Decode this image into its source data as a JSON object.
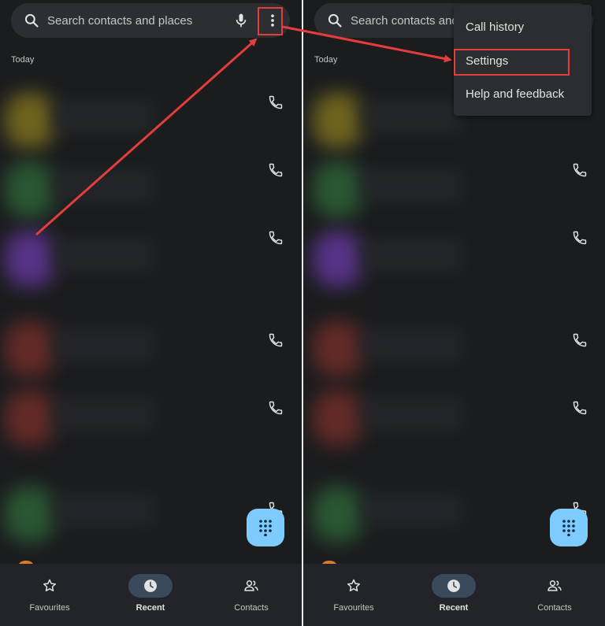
{
  "search": {
    "placeholder": "Search contacts and places"
  },
  "call_log": {
    "section_label": "Today"
  },
  "overflow_menu": {
    "items": [
      {
        "label": "Call history"
      },
      {
        "label": "Settings"
      },
      {
        "label": "Help and feedback"
      }
    ]
  },
  "bottom_nav": {
    "items": [
      {
        "label": "Favourites",
        "icon": "star-icon"
      },
      {
        "label": "Recent",
        "icon": "clock-icon",
        "active": true
      },
      {
        "label": "Contacts",
        "icon": "people-icon"
      }
    ]
  },
  "colors": {
    "background": "#1b1c1e",
    "search_bar": "#2c2e31",
    "fab": "#7ecbff",
    "highlight": "#e53c3c",
    "nav_bar": "#222427",
    "menu": "#2b2d31"
  },
  "blurred_avatar_colors": [
    "#8a7a1e",
    "#2f6b3a",
    "#6b3aa8",
    "#7a2f2a",
    "#7a2f2a",
    "#2f6b3a"
  ]
}
